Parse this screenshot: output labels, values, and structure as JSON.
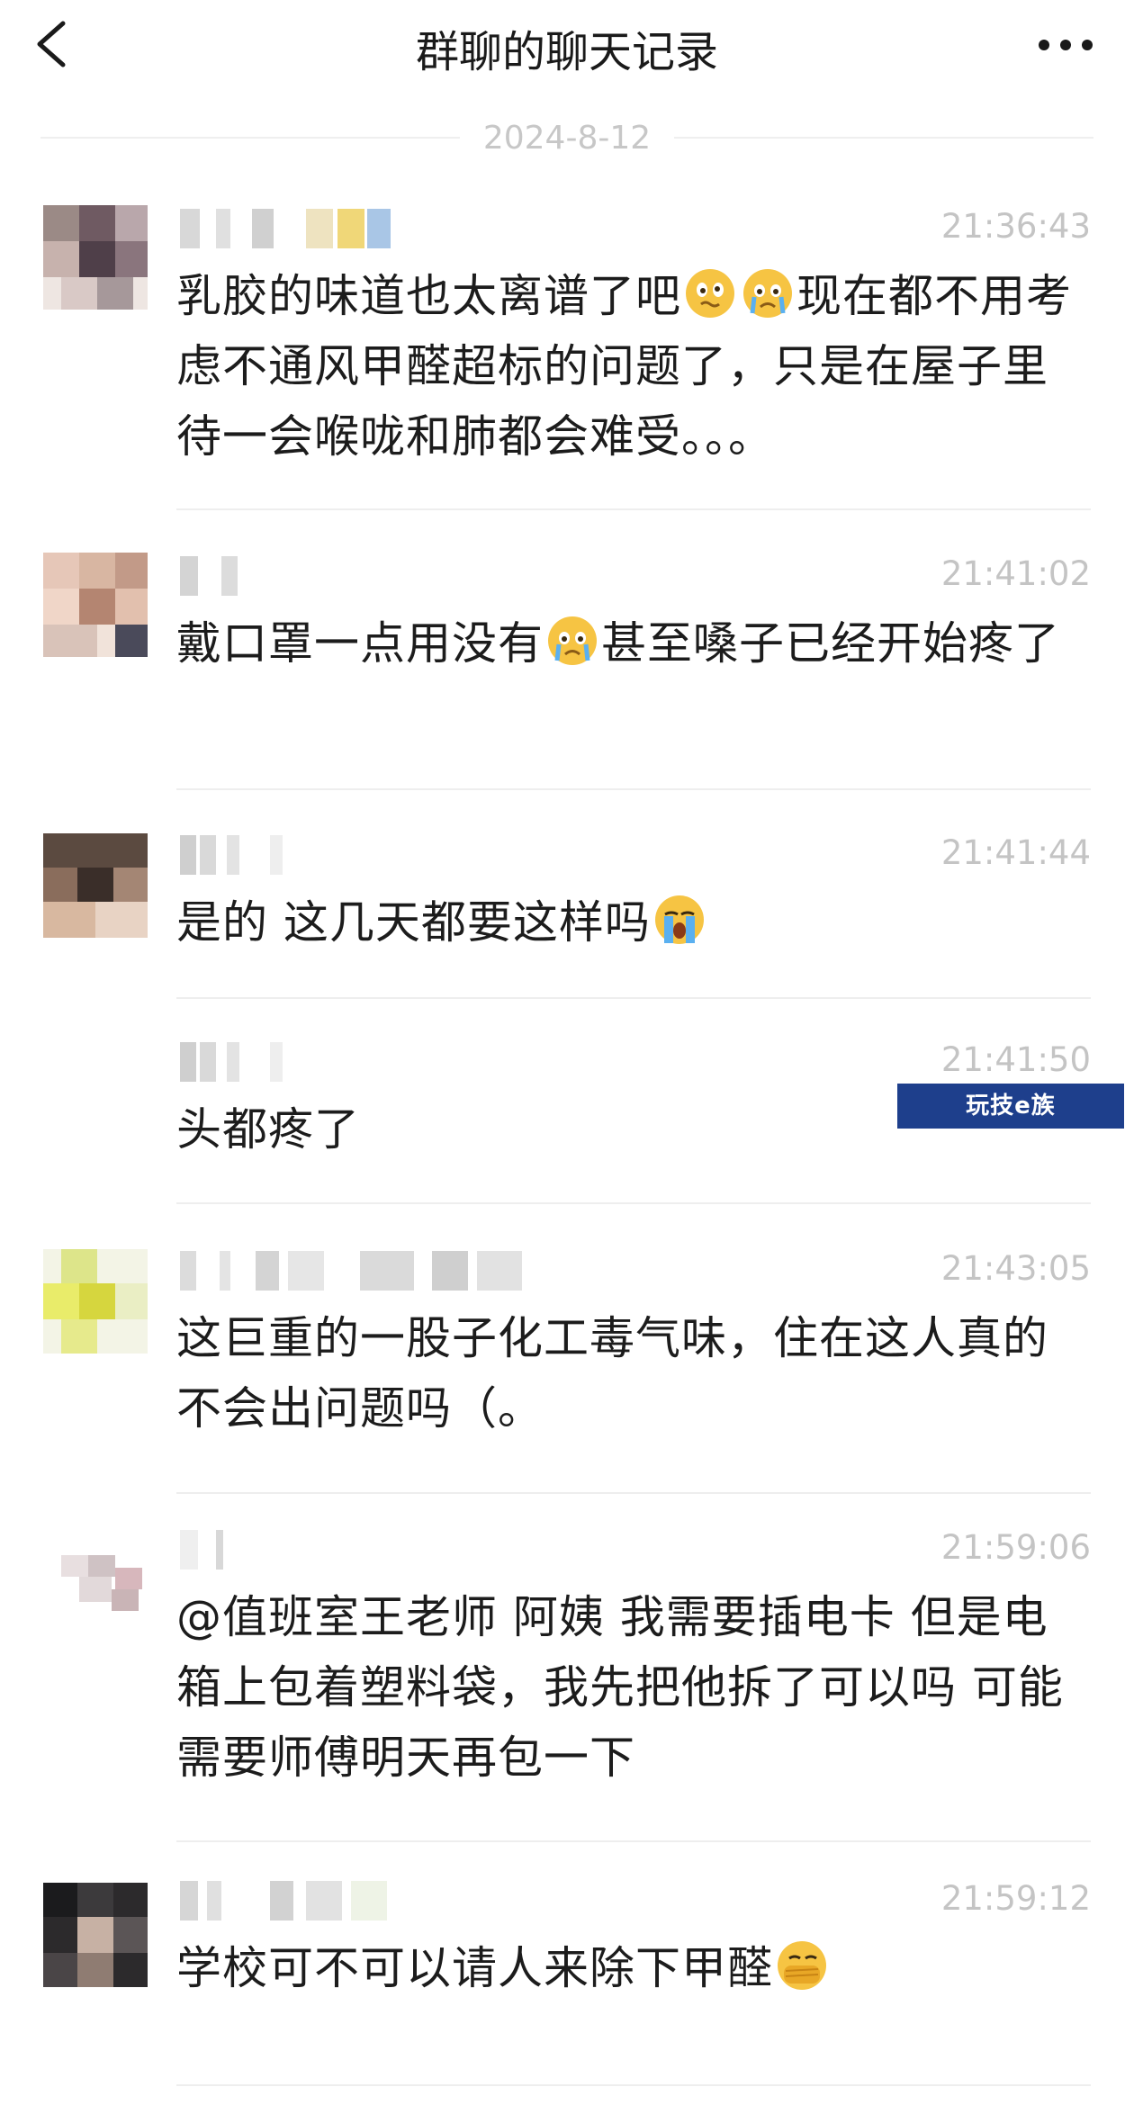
{
  "header": {
    "back_icon": "chevron-left-icon",
    "title": "群聊的聊天记录",
    "more_icon": "more-dots-icon"
  },
  "date_divider": "2024-8-12",
  "messages": [
    {
      "time": "21:36:43",
      "text": "乳胶的味道也太离谱了吧",
      "emoji_1": "woozy-face-icon",
      "emoji_2": "crying-face-icon",
      "text_after": "现在都不用考虑不通风甲醛超标的问题了，只是在屋子里待一会喉咙和肺都会难受。。。"
    },
    {
      "time": "21:41:02",
      "text": "戴口罩一点用没有",
      "emoji_1": "crying-face-icon",
      "text_after": "甚至嗓子已经开始疼了"
    },
    {
      "time": "21:41:44",
      "text": "是的 这几天都要这样吗",
      "emoji_1": "loudly-crying-face-icon"
    },
    {
      "time": "21:41:50",
      "text": "头都疼了"
    },
    {
      "time": "21:43:05",
      "text": "这巨重的一股子化工毒气味，住在这人真的不会出问题吗（。"
    },
    {
      "time": "21:59:06",
      "text": "@值班室王老师 阿姨 我需要插电卡 但是电箱上包着塑料袋，我先把他拆了可以吗 可能需要师傅明天再包一下"
    },
    {
      "time": "21:59:12",
      "text": "学校可不可以请人来除下甲醛",
      "emoji_1": "face-palm-icon"
    }
  ],
  "watermark": "玩技e族",
  "colors": {
    "background": "#ffffff",
    "text": "#1c1c1c",
    "timestamp": "#c4c4c4",
    "divider": "#eeeeee",
    "watermark_bg": "#1e3f8c"
  }
}
